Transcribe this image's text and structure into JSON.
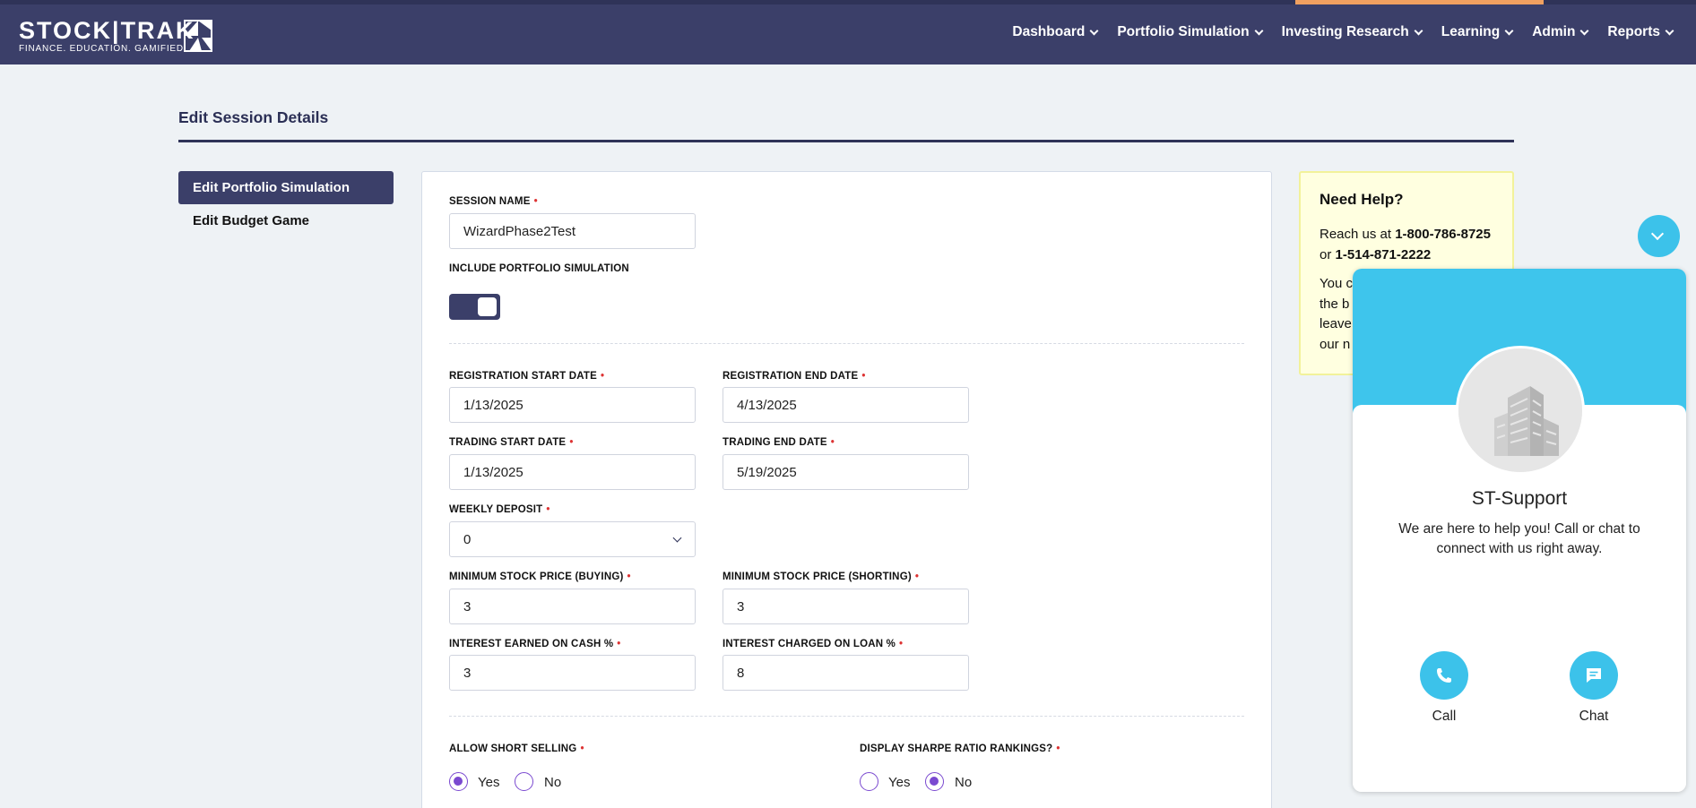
{
  "brand": {
    "logo_text": "STOCK|TRAK",
    "tagline": "FINANCE. EDUCATION. GAMIFIED."
  },
  "nav": {
    "items": [
      "Dashboard",
      "Portfolio Simulation",
      "Investing Research",
      "Learning",
      "Admin",
      "Reports"
    ]
  },
  "page": {
    "title": "Edit Session Details"
  },
  "sidebar": {
    "active": "Edit Portfolio Simulation",
    "other": "Edit Budget Game"
  },
  "form": {
    "session_name": {
      "label": "SESSION NAME",
      "value": "WizardPhase2Test"
    },
    "include_portfolio": {
      "label": "INCLUDE PORTFOLIO SIMULATION",
      "on": true
    },
    "reg_start": {
      "label": "REGISTRATION START DATE",
      "value": "1/13/2025"
    },
    "reg_end": {
      "label": "REGISTRATION END DATE",
      "value": "4/13/2025"
    },
    "trade_start": {
      "label": "TRADING START DATE",
      "value": "1/13/2025"
    },
    "trade_end": {
      "label": "TRADING END DATE",
      "value": "5/19/2025"
    },
    "weekly_deposit": {
      "label": "WEEKLY DEPOSIT",
      "value": "0"
    },
    "min_price_buy": {
      "label": "MINIMUM STOCK PRICE (BUYING)",
      "value": "3"
    },
    "min_price_short": {
      "label": "MINIMUM STOCK PRICE (SHORTING)",
      "value": "3"
    },
    "interest_cash": {
      "label": "INTEREST EARNED ON CASH %",
      "value": "3"
    },
    "interest_loan": {
      "label": "INTEREST CHARGED ON LOAN %",
      "value": "8"
    },
    "short_selling": {
      "label": "ALLOW SHORT SELLING",
      "yes": "Yes",
      "no": "No",
      "selected": "Yes"
    },
    "sharpe": {
      "label": "DISPLAY SHARPE RATIO RANKINGS?",
      "yes": "Yes",
      "no": "No",
      "selected": "No"
    },
    "required_mark": "•"
  },
  "help": {
    "title": "Need Help?",
    "reach_prefix": "Reach us at ",
    "phone1": "1-800-786-8725",
    "or": " or ",
    "phone2": "1-514-871-2222",
    "more_lines": [
      "You c",
      "the b",
      "leave",
      "our n"
    ]
  },
  "support": {
    "name": "ST-Support",
    "description": "We are here to help you! Call or chat to connect with us right away.",
    "call_label": "Call",
    "chat_label": "Chat"
  },
  "colors": {
    "navy": "#3b3f69",
    "accent_blue": "#3cc2ea",
    "radio_purple": "#7a49d0",
    "help_bg": "#ffffe0"
  }
}
